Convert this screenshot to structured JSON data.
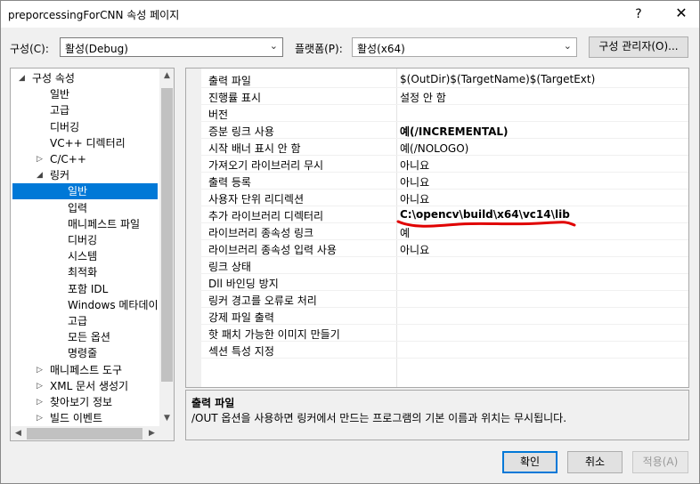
{
  "window": {
    "title": "preporcessingForCNN 속성 페이지",
    "help_label": "?",
    "close_label": "✕"
  },
  "top_bar": {
    "config_label": "구성(C):",
    "config_value": "활성(Debug)",
    "platform_label": "플랫폼(P):",
    "platform_value": "활성(x64)",
    "config_manager_label": "구성 관리자(O)..."
  },
  "tree": [
    {
      "label": "구성 속성",
      "level": 0,
      "expander": "open"
    },
    {
      "label": "일반",
      "level": 1
    },
    {
      "label": "고급",
      "level": 1
    },
    {
      "label": "디버깅",
      "level": 1
    },
    {
      "label": "VC++ 디렉터리",
      "level": 1
    },
    {
      "label": "C/C++",
      "level": 1,
      "expander": "closed"
    },
    {
      "label": "링커",
      "level": 1,
      "expander": "open"
    },
    {
      "label": "일반",
      "level": 2,
      "selected": true
    },
    {
      "label": "입력",
      "level": 2
    },
    {
      "label": "매니페스트 파일",
      "level": 2
    },
    {
      "label": "디버깅",
      "level": 2
    },
    {
      "label": "시스템",
      "level": 2
    },
    {
      "label": "최적화",
      "level": 2
    },
    {
      "label": "포함 IDL",
      "level": 2
    },
    {
      "label": "Windows 메타데이",
      "level": 2
    },
    {
      "label": "고급",
      "level": 2
    },
    {
      "label": "모든 옵션",
      "level": 2
    },
    {
      "label": "명령줄",
      "level": 2
    },
    {
      "label": "매니페스트 도구",
      "level": 1,
      "expander": "closed"
    },
    {
      "label": "XML 문서 생성기",
      "level": 1,
      "expander": "closed"
    },
    {
      "label": "찾아보기 정보",
      "level": 1,
      "expander": "closed"
    },
    {
      "label": "빌드 이벤트",
      "level": 1,
      "expander": "closed"
    }
  ],
  "properties": [
    {
      "name": "출력 파일",
      "value": "$(OutDir)$(TargetName)$(TargetExt)"
    },
    {
      "name": "진행률 표시",
      "value": "설정 안 함"
    },
    {
      "name": "버전",
      "value": ""
    },
    {
      "name": "증분 링크 사용",
      "value": "예(/INCREMENTAL)",
      "bold": true
    },
    {
      "name": "시작 배너 표시 안 함",
      "value": "예(/NOLOGO)"
    },
    {
      "name": "가져오기 라이브러리 무시",
      "value": "아니요"
    },
    {
      "name": "출력 등록",
      "value": "아니요"
    },
    {
      "name": "사용자 단위 리디렉션",
      "value": "아니요"
    },
    {
      "name": "추가 라이브러리 디렉터리",
      "value": "C:\\opencv\\build\\x64\\vc14\\lib",
      "bold": true
    },
    {
      "name": "라이브러리 종속성 링크",
      "value": "예"
    },
    {
      "name": "라이브러리 종속성 입력 사용",
      "value": "아니요"
    },
    {
      "name": "링크 상태",
      "value": ""
    },
    {
      "name": "Dll 바인딩 방지",
      "value": ""
    },
    {
      "name": "링커 경고를 오류로 처리",
      "value": ""
    },
    {
      "name": "강제 파일 출력",
      "value": ""
    },
    {
      "name": "핫 패치 가능한 이미지 만들기",
      "value": ""
    },
    {
      "name": "섹션 특성 지정",
      "value": ""
    }
  ],
  "description": {
    "title": "출력 파일",
    "text": "/OUT 옵션을 사용하면 링커에서 만드는 프로그램의 기본 이름과 위치는 무시됩니다."
  },
  "buttons": {
    "ok": "확인",
    "cancel": "취소",
    "apply": "적용(A)"
  },
  "colors": {
    "selection": "#0078d7",
    "annotation": "#e00000"
  }
}
